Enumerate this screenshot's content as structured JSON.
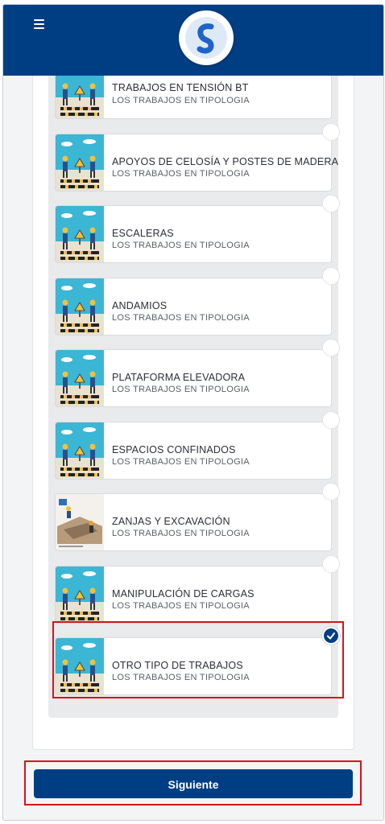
{
  "header": {
    "menu_icon": "hamburger-menu-icon",
    "logo_icon": "brand-logo-s-icon"
  },
  "items": [
    {
      "title": "TRABAJOS EN TENSIÓN BT",
      "subtitle": "LOS TRABAJOS EN TIPOLOGIA",
      "image": "construction-workers-illustration",
      "selected": false
    },
    {
      "title": "APOYOS DE CELOSÍA Y POSTES DE MADERA",
      "subtitle": "LOS TRABAJOS EN TIPOLOGIA",
      "image": "construction-workers-illustration",
      "selected": false
    },
    {
      "title": "ESCALERAS",
      "subtitle": "LOS TRABAJOS EN TIPOLOGIA",
      "image": "construction-workers-illustration",
      "selected": false
    },
    {
      "title": "ANDAMIOS",
      "subtitle": "LOS TRABAJOS EN TIPOLOGIA",
      "image": "construction-workers-illustration",
      "selected": false
    },
    {
      "title": "PLATAFORMA ELEVADORA",
      "subtitle": "LOS TRABAJOS EN TIPOLOGIA",
      "image": "construction-workers-illustration",
      "selected": false
    },
    {
      "title": "ESPACIOS CONFINADOS",
      "subtitle": "LOS TRABAJOS EN TIPOLOGIA",
      "image": "construction-workers-illustration",
      "selected": false
    },
    {
      "title": "ZANJAS Y EXCAVACIÓN",
      "subtitle": "LOS TRABAJOS EN TIPOLOGIA",
      "image": "excavation-illustration",
      "selected": false
    },
    {
      "title": "MANIPULACIÓN DE CARGAS",
      "subtitle": "LOS TRABAJOS EN TIPOLOGIA",
      "image": "construction-workers-illustration",
      "selected": false
    },
    {
      "title": "OTRO TIPO DE TRABAJOS",
      "subtitle": "LOS TRABAJOS EN TIPOLOGIA",
      "image": "construction-workers-illustration",
      "selected": true
    }
  ],
  "footer": {
    "next_label": "Siguiente"
  },
  "colors": {
    "brand": "#003e84",
    "highlight": "#d4141c",
    "sky": "#3bb6d4"
  }
}
